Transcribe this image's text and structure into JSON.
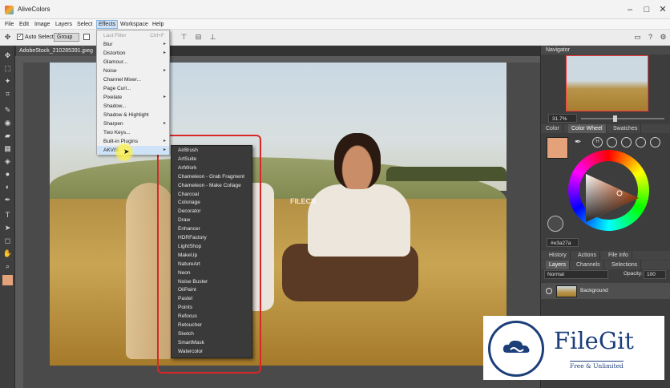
{
  "window": {
    "title": "AliveColors",
    "controls": [
      "–",
      "□",
      "✕"
    ]
  },
  "menubar": [
    "File",
    "Edit",
    "Image",
    "Layers",
    "Select",
    "Effects",
    "Workspace",
    "Help"
  ],
  "options": {
    "auto_select_label": "Auto Select",
    "group_value": "Group"
  },
  "document": {
    "tab_label": "AdobeStock_210285391.jpeg",
    "canvas_watermark": "FILECR"
  },
  "effects_menu": {
    "items": [
      {
        "label": "Last Filter",
        "shortcut": "Ctrl+F",
        "disabled": true
      },
      {
        "label": "Blur",
        "submenu": true
      },
      {
        "label": "Distortion",
        "submenu": true
      },
      {
        "label": "Glamour..."
      },
      {
        "label": "Noise",
        "submenu": true
      },
      {
        "label": "Channel Mixer..."
      },
      {
        "label": "Page Curl..."
      },
      {
        "label": "Pixelate",
        "submenu": true
      },
      {
        "label": "Shadow..."
      },
      {
        "label": "Shadow & Highlight"
      },
      {
        "label": "Sharpen",
        "submenu": true
      },
      {
        "label": "Two Keys..."
      },
      {
        "label": "Built-in Plugins",
        "submenu": true
      },
      {
        "label": "AKVIS",
        "submenu": true,
        "hover": true
      }
    ]
  },
  "akvis_menu": {
    "items": [
      "AirBrush",
      "ArtSuite",
      "ArtWork",
      "Chameleon - Grab Fragment",
      "Chameleon - Make Collage",
      "Charcoal",
      "Coloriage",
      "Decorator",
      "Draw",
      "Enhancer",
      "HDRFactory",
      "LightShop",
      "MakeUp",
      "NatureArt",
      "Neon",
      "Noise Buster",
      "OilPaint",
      "Pastel",
      "Points",
      "Refocus",
      "Retoucher",
      "Sketch",
      "SmartMask",
      "Watercolor"
    ]
  },
  "navigator": {
    "title": "Navigator",
    "zoom": "31.7%"
  },
  "color_panel": {
    "tabs": [
      "Color",
      "Color Wheel",
      "Swatches"
    ],
    "active_tab": "Color Wheel",
    "current_color": "#e3a27a",
    "hex_value": "#e3a27a"
  },
  "history_panel": {
    "tabs": [
      "History",
      "Actions",
      "File Info"
    ]
  },
  "layers_panel": {
    "tabs": [
      "Layers",
      "Channels",
      "Selections"
    ],
    "blend_mode": "Normal",
    "opacity_label": "Opacity:",
    "opacity_value": "100",
    "layers": [
      {
        "name": "Background"
      }
    ]
  },
  "badge": {
    "name": "FileGit",
    "tagline": "Free & Unlimited"
  },
  "colors": {
    "accent_red": "#d62828",
    "highlight": "#f5ea3a",
    "brand_blue": "#1c3f7a"
  }
}
